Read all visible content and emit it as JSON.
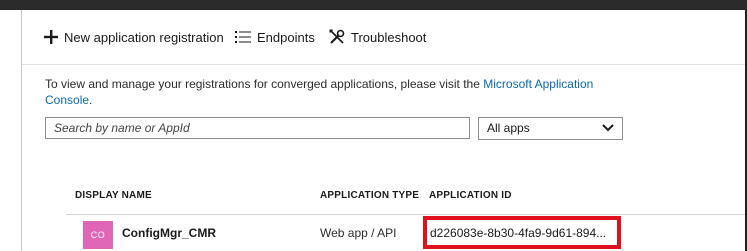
{
  "toolbar": {
    "new_label": "New application registration",
    "endpoints_label": "Endpoints",
    "troubleshoot_label": "Troubleshoot"
  },
  "info": {
    "text": "To view and manage your registrations for converged applications, please visit the ",
    "link_line1": "Microsoft Application",
    "link_line2": "Console",
    "trailing": "."
  },
  "search": {
    "placeholder": "Search by name or AppId"
  },
  "filter": {
    "selected": "All apps"
  },
  "table": {
    "headers": {
      "name": "DISPLAY NAME",
      "type": "APPLICATION TYPE",
      "id": "APPLICATION ID"
    },
    "rows": [
      {
        "avatar": "CO",
        "name": "ConfigMgr_CMR",
        "type": "Web app / API",
        "id": "d226083e-8b30-4fa9-9d61-894..."
      }
    ]
  },
  "colors": {
    "link": "#0a68b4",
    "avatar": "#e066b8",
    "highlight": "#e0101e"
  }
}
